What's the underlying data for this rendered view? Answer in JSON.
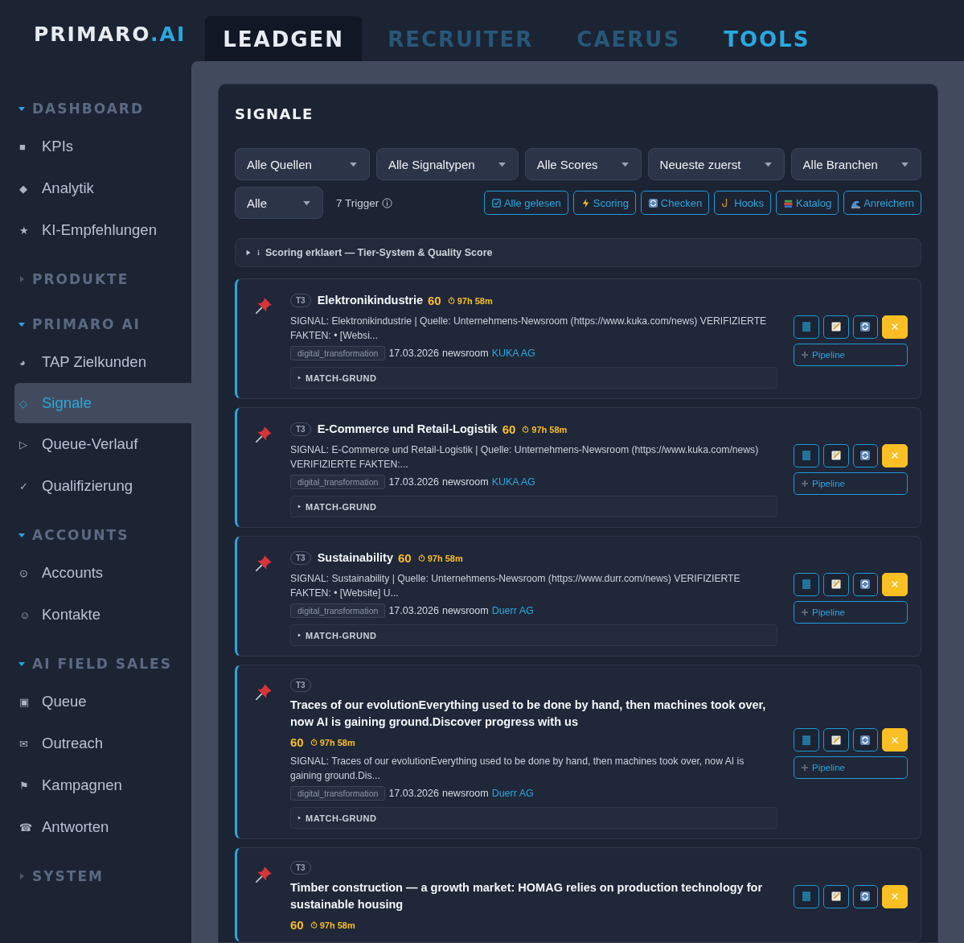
{
  "logo": {
    "name": "PRIMARO",
    "suffix": ".AI"
  },
  "tabs": [
    {
      "label": "LEADGEN",
      "selected": true,
      "color": "#e8ecf2"
    },
    {
      "label": "RECRUITER",
      "selected": false,
      "color": "#275778"
    },
    {
      "label": "CAERUS",
      "selected": false,
      "color": "#275778"
    },
    {
      "label": "TOOLS",
      "selected": false,
      "color": "#29a8e0"
    }
  ],
  "sidebar": {
    "sections": [
      {
        "title": "DASHBOARD",
        "expanded": true,
        "items": [
          {
            "icon": "■",
            "label": "KPIs",
            "selected": false
          },
          {
            "icon": "◆",
            "label": "Analytik",
            "selected": false
          },
          {
            "icon": "★",
            "label": "KI-Empfehlungen",
            "selected": false
          }
        ]
      },
      {
        "title": "PRODUKTE",
        "expanded": false
      },
      {
        "title": "PRIMARO AI",
        "expanded": true,
        "items": [
          {
            "icon": "◕",
            "label": "TAP Zielkunden",
            "selected": false
          },
          {
            "icon": "◇",
            "label": "Signale",
            "selected": true
          },
          {
            "icon": "▷",
            "label": "Queue-Verlauf",
            "selected": false
          },
          {
            "icon": "✓",
            "label": "Qualifizierung",
            "selected": false
          }
        ]
      },
      {
        "title": "ACCOUNTS",
        "expanded": true,
        "items": [
          {
            "icon": "⊙",
            "label": "Accounts",
            "selected": false
          },
          {
            "icon": "☺",
            "label": "Kontakte",
            "selected": false
          }
        ]
      },
      {
        "title": "AI FIELD SALES",
        "expanded": true,
        "items": [
          {
            "icon": "▣",
            "label": "Queue",
            "selected": false
          },
          {
            "icon": "✉",
            "label": "Outreach",
            "selected": false
          },
          {
            "icon": "⚑",
            "label": "Kampagnen",
            "selected": false
          },
          {
            "icon": "☎",
            "label": "Antworten",
            "selected": false
          }
        ]
      },
      {
        "title": "SYSTEM",
        "expanded": false
      }
    ]
  },
  "page": {
    "title": "SIGNALE",
    "filters": [
      {
        "value": "Alle Quellen"
      },
      {
        "value": "Alle Signaltypen"
      },
      {
        "value": "Alle Scores"
      },
      {
        "value": "Neueste zuerst"
      },
      {
        "value": "Alle Branchen"
      }
    ],
    "status_filter": {
      "value": "Alle"
    },
    "trigger_count": "7 Trigger",
    "actions": [
      {
        "kind": "check",
        "label": "Alle gelesen"
      },
      {
        "kind": "bolt",
        "label": "Scoring"
      },
      {
        "kind": "refresh",
        "label": "Checken"
      },
      {
        "kind": "hook",
        "label": "Hooks"
      },
      {
        "kind": "books",
        "label": "Katalog"
      },
      {
        "kind": "wave",
        "label": "Anreichern"
      }
    ],
    "explainer": {
      "label": "Scoring erklaert — Tier-System & Quality Score",
      "expanded": false
    },
    "signals": [
      {
        "tier": "T3",
        "title": "Elektronikindustrie",
        "score": "60",
        "age": "97h 58m",
        "text": "SIGNAL: Elektronikindustrie | Quelle: Unternehmens-Newsroom (https://www.kuka.com/news) VERIFIZIERTE FAKTEN: • [Websi...",
        "tag": "digital_transformation",
        "date": "17.03.2026",
        "source": "newsroom",
        "company": "KUKA AG",
        "match": "MATCH-GRUND",
        "pipeline": "Pipeline"
      },
      {
        "tier": "T3",
        "title": "E-Commerce und Retail-Logistik",
        "score": "60",
        "age": "97h 58m",
        "text": "SIGNAL: E-Commerce und Retail-Logistik | Quelle: Unternehmens-Newsroom (https://www.kuka.com/news) VERIFIZIERTE FAKTEN:...",
        "tag": "digital_transformation",
        "date": "17.03.2026",
        "source": "newsroom",
        "company": "KUKA AG",
        "match": "MATCH-GRUND",
        "pipeline": "Pipeline"
      },
      {
        "tier": "T3",
        "title": "Sustainability",
        "score": "60",
        "age": "97h 58m",
        "text": "SIGNAL: Sustainability | Quelle: Unternehmens-Newsroom (https://www.durr.com/news) VERIFIZIERTE FAKTEN: • [Website] U...",
        "tag": "digital_transformation",
        "date": "17.03.2026",
        "source": "newsroom",
        "company": "Duerr AG",
        "match": "MATCH-GRUND",
        "pipeline": "Pipeline"
      },
      {
        "tier": "T3",
        "title": "Traces of our evolutionEverything used to be done by hand, then machines took over, now AI is gaining ground.Discover progress with us",
        "score": "60",
        "age": "97h 58m",
        "text": "SIGNAL: Traces of our evolutionEverything used to be done by hand, then machines took over, now AI is gaining ground.Dis...",
        "tag": "digital_transformation",
        "date": "17.03.2026",
        "source": "newsroom",
        "company": "Duerr AG",
        "match": "MATCH-GRUND",
        "pipeline": "Pipeline"
      },
      {
        "tier": "T3",
        "title": "Timber construction — a growth market: HOMAG relies on production technology for sustainable housing",
        "score": "60",
        "age": "97h 58m"
      }
    ]
  }
}
